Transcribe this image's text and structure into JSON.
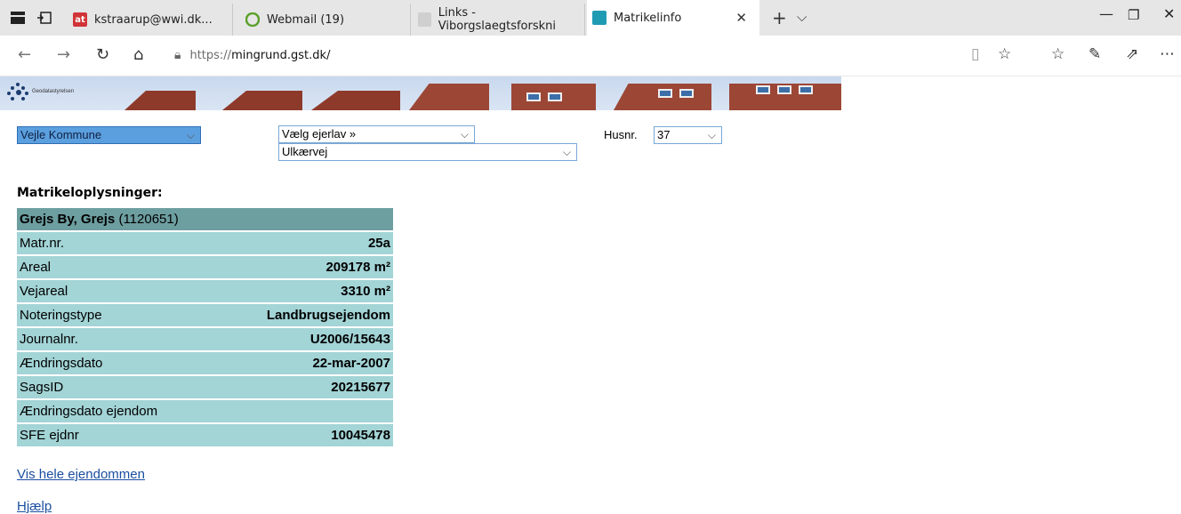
{
  "browser": {
    "tabs": [
      {
        "label": "kstraarup@wwi.dk...",
        "favicon_text": "at",
        "favicon_color": "#d13438"
      },
      {
        "label": "Webmail (19)",
        "favicon_text": "",
        "favicon_color": "#5aa02c"
      },
      {
        "label": "Links - Viborgslaegtsforskni",
        "favicon_text": "",
        "favicon_color": "#c9c9c9"
      },
      {
        "label": "Matrikelinfo",
        "favicon_text": "",
        "favicon_color": "#1f9bb4"
      }
    ],
    "url_scheme": "https://",
    "url_host": "mingrund.gst.dk/",
    "new_tab": "+",
    "tab_menu": "⌵"
  },
  "banner": {
    "logo_text": "Geodatastyrelsen"
  },
  "selectors": {
    "kommune": "Vejle Kommune",
    "ejerlav": "Vælg ejerlav  »",
    "vej": "Ulkærvej",
    "husnr_label": "Husnr.",
    "husnr": "37"
  },
  "matrikel": {
    "heading": "Matrikeloplysninger:",
    "title_bold": "Grejs By, Grejs",
    "title_id": " (1120651)",
    "rows": [
      {
        "label": "Matr.nr.",
        "value": "25a"
      },
      {
        "label": "Areal",
        "value": "209178 m²"
      },
      {
        "label": "Vejareal",
        "value": "3310 m²"
      },
      {
        "label": "Noteringstype",
        "value": "Landbrugsejendom"
      },
      {
        "label": "Journalnr.",
        "value": "U2006/15643"
      },
      {
        "label": "Ændringsdato",
        "value": "22-mar-2007"
      },
      {
        "label": "SagsID",
        "value": "20215677"
      },
      {
        "label": "Ændringsdato ejendom",
        "value": ""
      },
      {
        "label": "SFE ejdnr",
        "value": "10045478"
      }
    ],
    "link_vis": "Vis hele ejendommen",
    "link_help": "Hjælp"
  }
}
